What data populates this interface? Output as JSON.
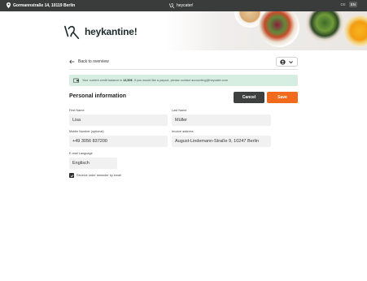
{
  "topbar": {
    "address": "Gormannstraße 14, 10119 Berlin",
    "brand": "heycater!",
    "languages": [
      "DE",
      "EN"
    ],
    "active_language": "EN"
  },
  "hero": {
    "logo_text": "heykantine!"
  },
  "nav": {
    "back_label": "Back to overview"
  },
  "credit_banner": {
    "prefix": "Your current credit balance is ",
    "amount": "13,50€",
    "suffix": ". If you would like a payout, please contact accounting@heycater.com"
  },
  "form": {
    "title": "Personal information",
    "cancel_label": "Cancel",
    "save_label": "Save",
    "first_name": {
      "label": "First Name",
      "value": "Lisa"
    },
    "last_name": {
      "label": "Last Name",
      "value": "Müller"
    },
    "mobile": {
      "label": "Mobile Number (optional)",
      "value": "+49 3056  837200"
    },
    "invoice_address": {
      "label": "Invoice address",
      "value": "August-Lindemann-Straße 9, 10247 Berlin"
    },
    "email_language": {
      "label": "E-mail Language",
      "value": "Englisch"
    },
    "reminder_checkbox": {
      "label": "Receive order reminder by email",
      "checked": true
    }
  },
  "colors": {
    "topbar": "#3a3c3b",
    "banner": "#d6ede2",
    "cancel": "#3e403f",
    "save": "#f26a1b"
  }
}
